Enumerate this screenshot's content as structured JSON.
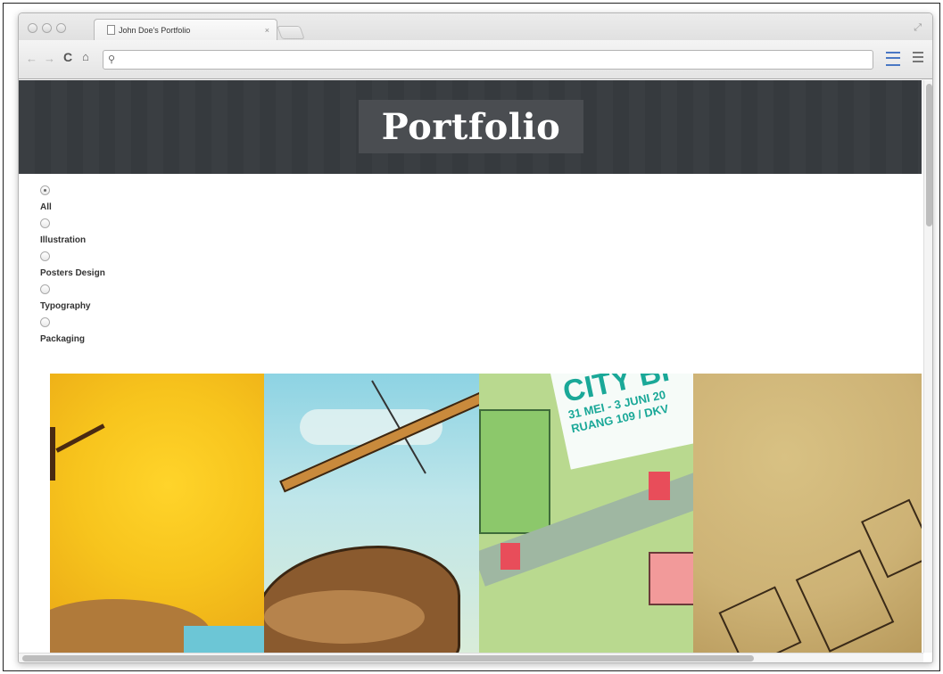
{
  "browser": {
    "tab_title": "John Doe's Portfolio",
    "tab_close": "×",
    "address_value": "",
    "nav_icons": [
      "back-icon",
      "forward-icon",
      "reload-icon",
      "home-icon",
      "search-icon",
      "bookmark-icon",
      "menu-icon"
    ]
  },
  "site": {
    "logo_text": "Portfolio",
    "header_color": "#3a3e42"
  },
  "filters": {
    "items": [
      {
        "label": "All",
        "checked": true
      },
      {
        "label": "Illustration",
        "checked": false
      },
      {
        "label": "Posters Design",
        "checked": false
      },
      {
        "label": "Typography",
        "checked": false
      },
      {
        "label": "Packaging",
        "checked": false
      }
    ]
  },
  "gallery": {
    "poster_text": {
      "line1": "CITY BI",
      "line2": "31 MEI - 3 JUNI 20",
      "line3": "RUANG 109 / DKV"
    }
  }
}
